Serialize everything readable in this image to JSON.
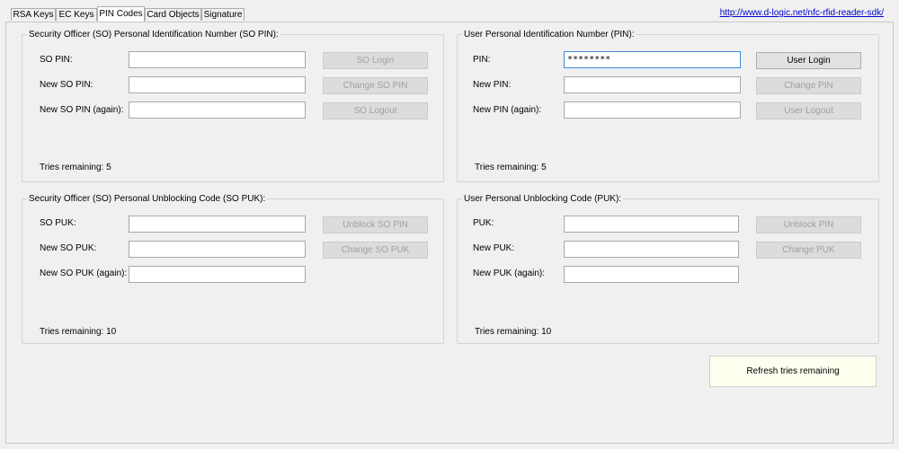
{
  "tabs": [
    "RSA Keys",
    "EC Keys",
    "PIN Codes",
    "Card Objects",
    "Signature"
  ],
  "link": "http://www.d-logic.net/nfc-rfid-reader-sdk/",
  "so_pin": {
    "title": "Security Officer (SO) Personal Identification Number (SO PIN):",
    "label1": "SO PIN:",
    "label2": "New SO PIN:",
    "label3": "New SO PIN (again):",
    "btn1": "SO Login",
    "btn2": "Change SO PIN",
    "btn3": "SO Logout",
    "tries": "Tries remaining: 5"
  },
  "user_pin": {
    "title": "User Personal Identification Number (PIN):",
    "label1": "PIN:",
    "label2": "New PIN:",
    "label3": "New PIN (again):",
    "value1": "********",
    "btn1": "User Login",
    "btn2": "Change PIN",
    "btn3": "User Logout",
    "tries": "Tries remaining: 5"
  },
  "so_puk": {
    "title": "Security Officer (SO) Personal Unblocking Code (SO PUK):",
    "label1": "SO PUK:",
    "label2": "New SO PUK:",
    "label3": "New SO PUK (again):",
    "btn1": "Unblock SO PIN",
    "btn2": "Change SO PUK",
    "tries": "Tries remaining: 10"
  },
  "user_puk": {
    "title": "User Personal Unblocking Code (PUK):",
    "label1": "PUK:",
    "label2": "New PUK:",
    "label3": "New PUK (again):",
    "btn1": "Unblock PIN",
    "btn2": "Change PUK",
    "tries": "Tries remaining: 10"
  },
  "refresh_label": "Refresh tries remaining"
}
